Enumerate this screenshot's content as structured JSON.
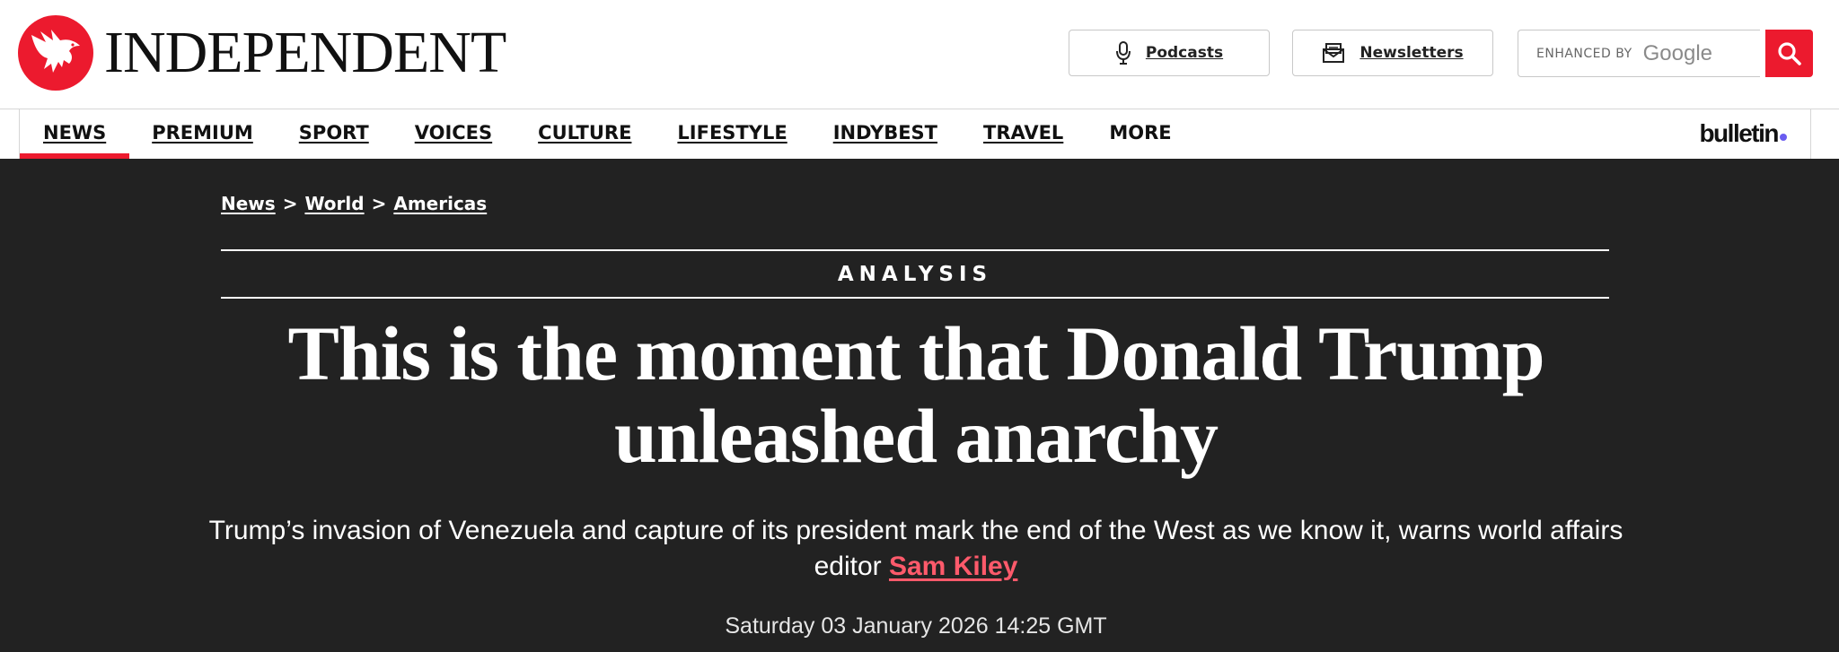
{
  "brand": {
    "name": "INDEPENDENT",
    "accent_color": "#ec1a2e",
    "logo_icon": "eagle-icon"
  },
  "header": {
    "podcasts_label": "Podcasts",
    "podcasts_icon": "microphone-icon",
    "newsletters_label": "Newsletters",
    "newsletters_icon": "envelope-icon",
    "search": {
      "enhanced_by": "ENHANCED BY",
      "provider": "Google",
      "button_icon": "search-icon"
    }
  },
  "nav": {
    "items": [
      {
        "label": "NEWS",
        "active": true
      },
      {
        "label": "PREMIUM"
      },
      {
        "label": "SPORT"
      },
      {
        "label": "VOICES"
      },
      {
        "label": "CULTURE"
      },
      {
        "label": "LIFESTYLE"
      },
      {
        "label": "INDYBEST"
      },
      {
        "label": "TRAVEL"
      },
      {
        "label": "MORE"
      }
    ],
    "bulletin": "bulletin",
    "bulletin_dot_color": "#6a5cf0"
  },
  "breadcrumb": {
    "items": [
      "News",
      "World",
      "Americas"
    ],
    "separator": ">"
  },
  "article": {
    "kicker": "ANALYSIS",
    "headline_line1": "This is the moment that Donald Trump",
    "headline_line2": "unleashed anarchy",
    "standfirst": "Trump’s invasion of Venezuela and capture of its president mark the end of the West as we know it, warns world affairs editor",
    "author": "Sam Kiley",
    "author_color": "#ff5a6b",
    "date": "Saturday 03 January 2026 14:25 GMT",
    "background": "#222222"
  }
}
